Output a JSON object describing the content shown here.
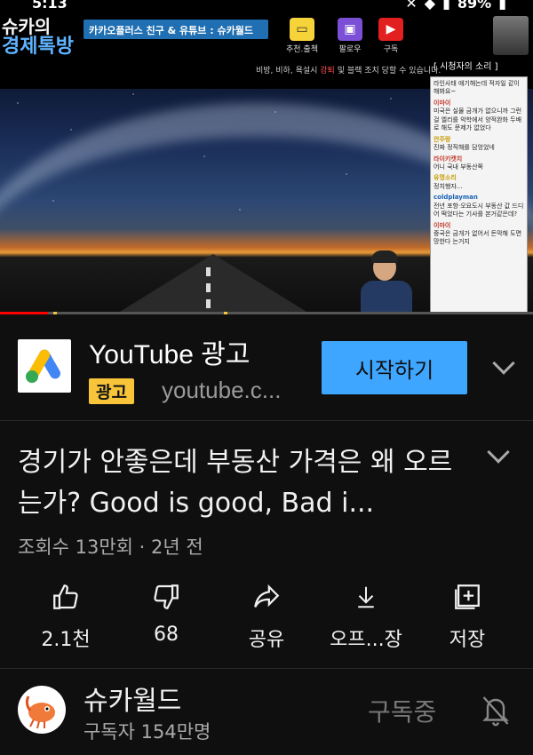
{
  "status_bar": {
    "time": "5:13",
    "battery": "89%"
  },
  "video": {
    "brand_line1": "슈카의",
    "brand_line2": "경제톡방",
    "promo_text": "카카오플러스 친구 & 유튜브 : 슈카월드",
    "buttons": [
      {
        "label": "추천.출첵",
        "icon": "kakao-icon",
        "color": "#f7d33a"
      },
      {
        "label": "팔로우",
        "icon": "twitch-icon",
        "color": "#7b4fd6"
      },
      {
        "label": "구독",
        "icon": "youtube-icon",
        "color": "#e32020"
      }
    ],
    "warning_prefix": "비방, 비하, 욕설시 ",
    "warning_red": "강퇴",
    "warning_suffix": " 및 블랙 조치 당할 수 있습니다.",
    "viewer_panel_title": "[ 시청자의 소리 ]",
    "chat": [
      {
        "name": "",
        "text": "라인사태 얘기해는데 적자일 같이 해봐요~",
        "color": "b"
      },
      {
        "name": "이마이",
        "text": "미국은 실물 금개가 없으니까 그런걸 엘리를 악학에서 양적완화 두배로 해도 문제가 없었다",
        "color": ""
      },
      {
        "name": "안주랑",
        "text": "진짜 정직해를 담엉었네",
        "color": "y"
      },
      {
        "name": "라이키캣치",
        "text": "어니 국내 부동산쪽",
        "color": ""
      },
      {
        "name": "유명소리",
        "text": "정치행자...",
        "color": "y"
      },
      {
        "name": "coldplayman",
        "text": "전년 포항·오요도시 부동산 값 드디어 떡었다는 기사를 본거같은데?",
        "color": "b"
      },
      {
        "name": "이마이",
        "text": "중국은 금개가 없어서 돈막해 도면 망한다 는거지",
        "color": ""
      }
    ],
    "progress": 0.09,
    "ad_markers": [
      0.1,
      0.42
    ]
  },
  "ad": {
    "title": "YouTube 광고",
    "badge": "광고",
    "url": "youtube.c...",
    "cta": "시작하기"
  },
  "video_info": {
    "title": "경기가 안좋은데 부동산 가격은 왜 오르는가? Good is good,  Bad  i...",
    "meta": "조회수 13만회 · 2년 전"
  },
  "actions": [
    {
      "label": "2.1천",
      "icon": "thumbs-up-icon"
    },
    {
      "label": "68",
      "icon": "thumbs-down-icon"
    },
    {
      "label": "공유",
      "icon": "share-icon"
    },
    {
      "label": "오프...장",
      "icon": "download-icon"
    },
    {
      "label": "저장",
      "icon": "save-to-playlist-icon"
    }
  ],
  "channel": {
    "name": "슈카월드",
    "subscribers": "구독자 154만명",
    "subscribe_state": "구독중"
  }
}
